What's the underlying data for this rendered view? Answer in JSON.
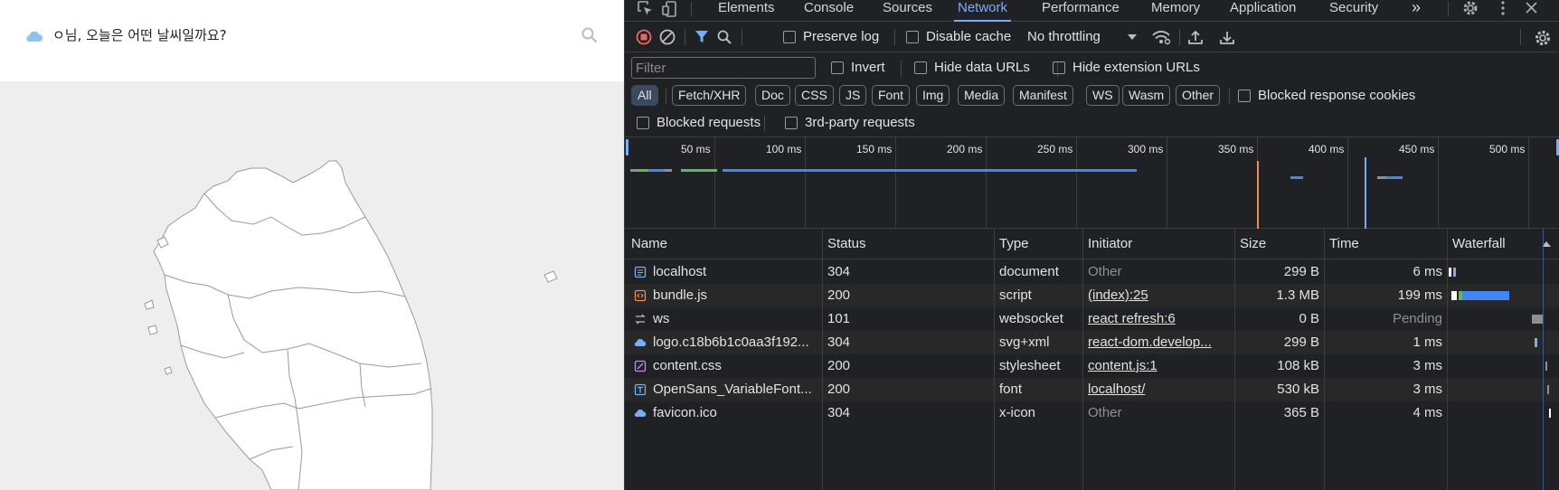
{
  "app": {
    "title": "ㅇ님, 오늘은 어떤 날씨일까요?",
    "logo_icon": "cloud-icon",
    "search_icon": "search-icon"
  },
  "devtools": {
    "tabs": [
      "Elements",
      "Console",
      "Sources",
      "Network",
      "Performance",
      "Memory",
      "Application",
      "Security"
    ],
    "active_tab": "Network",
    "more_tabs_glyph": "»",
    "toolbar": {
      "preserve_log": "Preserve log",
      "disable_cache": "Disable cache",
      "throttling": "No throttling"
    },
    "filter": {
      "placeholder": "Filter",
      "invert": "Invert",
      "hide_data_urls": "Hide data URLs",
      "hide_extension_urls": "Hide extension URLs"
    },
    "type_filters": [
      "All",
      "Fetch/XHR",
      "Doc",
      "CSS",
      "JS",
      "Font",
      "Img",
      "Media",
      "Manifest",
      "WS",
      "Wasm",
      "Other"
    ],
    "blocked_response_cookies": "Blocked response cookies",
    "blocked_requests": "Blocked requests",
    "third_party_requests": "3rd-party requests",
    "timeline_ticks": [
      "50 ms",
      "100 ms",
      "150 ms",
      "200 ms",
      "250 ms",
      "300 ms",
      "350 ms",
      "400 ms",
      "450 ms",
      "500 ms"
    ],
    "columns": {
      "name": "Name",
      "status": "Status",
      "type": "Type",
      "initiator": "Initiator",
      "size": "Size",
      "time": "Time",
      "waterfall": "Waterfall"
    },
    "rows": [
      {
        "name": "localhost",
        "status": "304",
        "type": "document",
        "initiator": "Other",
        "size": "299 B",
        "time": "6 ms",
        "icon": "document-icon",
        "icon_color": "#7cacf8"
      },
      {
        "name": "bundle.js",
        "status": "200",
        "type": "script",
        "initiator": "(index):25",
        "size": "1.3 MB",
        "time": "199 ms",
        "icon": "script-icon",
        "icon_color": "#f28b54"
      },
      {
        "name": "ws",
        "status": "101",
        "type": "websocket",
        "initiator": "react refresh:6",
        "size": "0 B",
        "time": "Pending",
        "icon": "websocket-icon",
        "icon_color": "#bdbdbd"
      },
      {
        "name": "logo.c18b6b1c0aa3f192...",
        "status": "304",
        "type": "svg+xml",
        "initiator": "react-dom.develop...",
        "size": "299 B",
        "time": "1 ms",
        "icon": "image-icon",
        "icon_color": "#7cacf8"
      },
      {
        "name": "content.css",
        "status": "200",
        "type": "stylesheet",
        "initiator": "content.js:1",
        "size": "108 kB",
        "time": "3 ms",
        "icon": "stylesheet-icon",
        "icon_color": "#c58af9"
      },
      {
        "name": "OpenSans_VariableFont...",
        "status": "200",
        "type": "font",
        "initiator": "localhost/",
        "size": "530 kB",
        "time": "3 ms",
        "icon": "font-icon",
        "icon_color": "#7cacf8"
      },
      {
        "name": "favicon.ico",
        "status": "304",
        "type": "x-icon",
        "initiator": "Other",
        "size": "365 B",
        "time": "4 ms",
        "icon": "image-icon",
        "icon_color": "#7cacf8"
      }
    ]
  }
}
